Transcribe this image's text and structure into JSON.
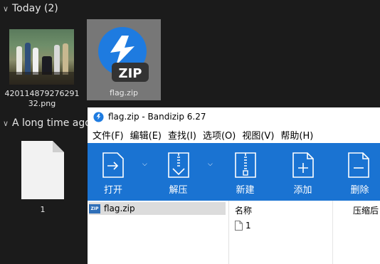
{
  "explorer": {
    "groups": [
      {
        "label": "Today (2)"
      },
      {
        "label": "A long time ago"
      }
    ],
    "files": [
      {
        "name": "42011487927629132.png",
        "caption": "420114879276291\n32.png"
      },
      {
        "name": "flag.zip",
        "caption": "flag.zip",
        "badge": "ZIP"
      },
      {
        "name": "1",
        "caption": "1"
      }
    ]
  },
  "bandizip": {
    "title": "flag.zip - Bandizip 6.27",
    "menu": [
      "文件(F)",
      "编辑(E)",
      "查找(I)",
      "选项(O)",
      "视图(V)",
      "帮助(H)"
    ],
    "toolbar": [
      {
        "label": "打开",
        "icon": "open-folder-icon"
      },
      {
        "label": "解压",
        "icon": "extract-icon"
      },
      {
        "label": "新建",
        "icon": "new-archive-icon"
      },
      {
        "label": "添加",
        "icon": "add-icon"
      },
      {
        "label": "删除",
        "icon": "delete-icon"
      }
    ],
    "tree": {
      "label": "flag.zip",
      "badge": "ZIP"
    },
    "columns": {
      "name": "名称",
      "compressed": "压缩后"
    },
    "files": [
      {
        "name": "1"
      }
    ]
  },
  "colors": {
    "explorer_bg": "#1b1b1b",
    "selection": "#777777",
    "bandizip_blue": "#1a73d2",
    "zip_logo_blue": "#1e7be0"
  }
}
